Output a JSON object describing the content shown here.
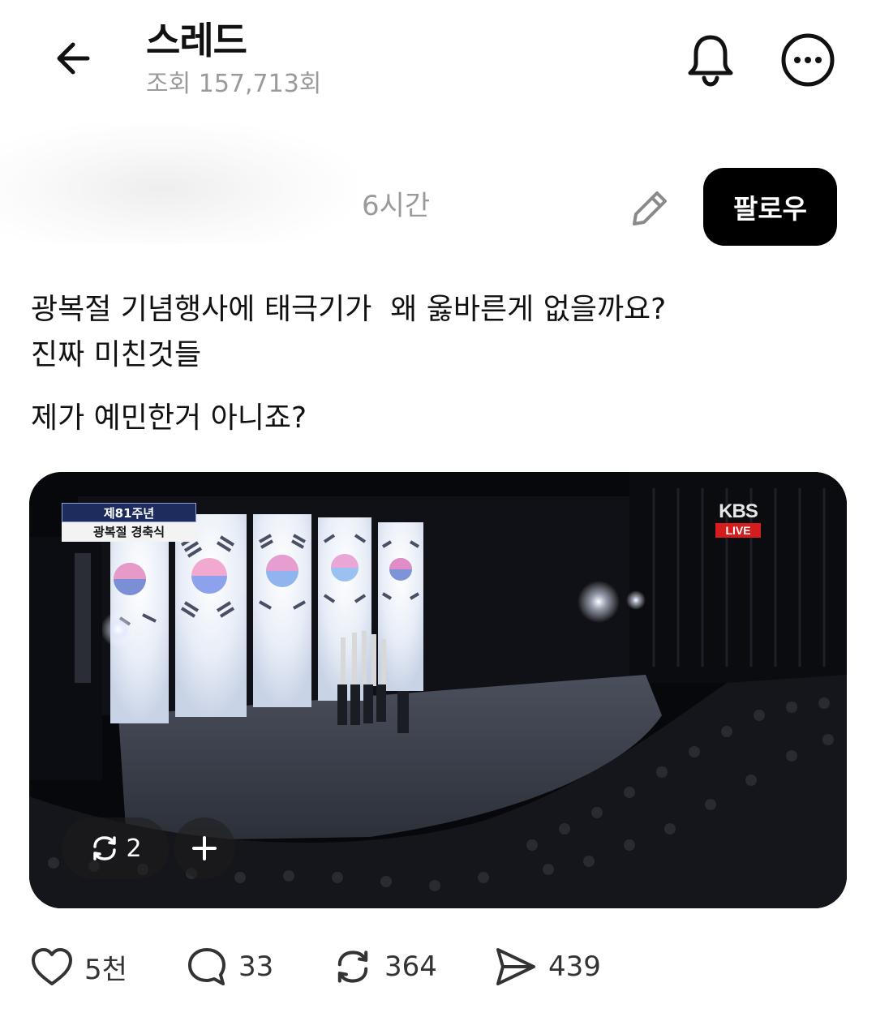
{
  "header": {
    "title": "스레드",
    "views": "조회 157,713회",
    "back_icon": "arrow-left-icon",
    "bell_icon": "bell-icon",
    "more_icon": "more-dots-icon"
  },
  "post": {
    "time": "6시간",
    "follow_label": "팔로우",
    "edit_icon": "pencil-icon",
    "text_lines": [
      "광복절 기념행사에 태극기가  왜 옳바른게 없을까요?",
      "진짜 미친것들",
      "제가 예민한거 아니죠?"
    ],
    "media": {
      "caption_line1": "제81주년",
      "caption_line2": "광복절 경축식",
      "broadcaster": "KBS",
      "live_label": "LIVE",
      "repost_count": "2"
    }
  },
  "actions": {
    "like": {
      "icon": "heart-icon",
      "count": "5천"
    },
    "comment": {
      "icon": "comment-bubble-icon",
      "count": "33"
    },
    "repost": {
      "icon": "repost-icon",
      "count": "364"
    },
    "share": {
      "icon": "send-icon",
      "count": "439"
    }
  },
  "colors": {
    "text": "#111111",
    "muted": "#9a9a9a",
    "follow_bg": "#000000",
    "follow_text": "#ffffff",
    "live_red": "#d61d1d"
  }
}
